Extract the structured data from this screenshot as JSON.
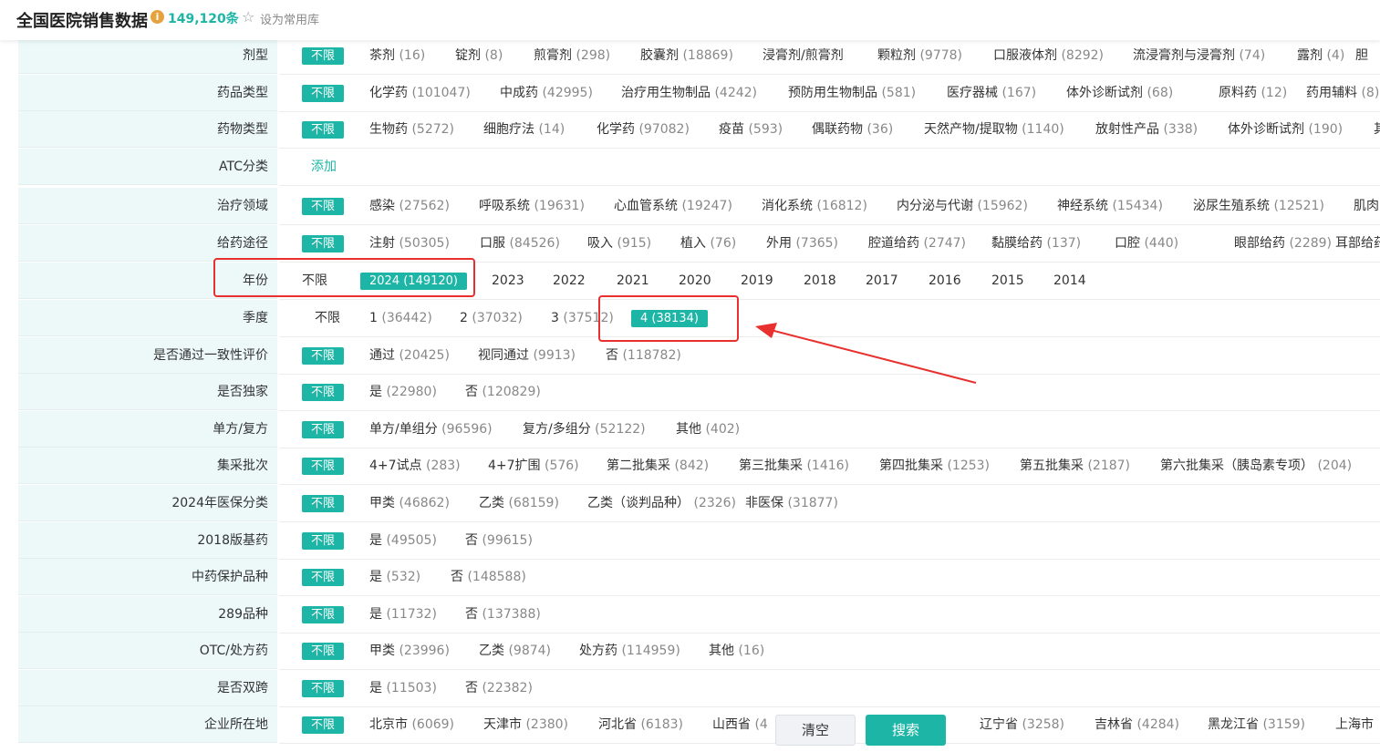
{
  "header": {
    "title": "全国医院销售数据",
    "info_icon": "i",
    "count": "149,120条",
    "star_icon": "☆",
    "favorite_label": "设为常用库"
  },
  "rows": [
    {
      "label": "剂型",
      "options": [
        {
          "text": "不限",
          "sel": true
        },
        {
          "text": "茶剂",
          "count": "(16)"
        },
        {
          "text": "锭剂",
          "count": "(8)"
        },
        {
          "text": "煎膏剂",
          "count": "(298)"
        },
        {
          "text": "胶囊剂",
          "count": "(18869)"
        },
        {
          "text": "浸膏剂/煎膏剂"
        },
        {
          "text": "颗粒剂",
          "count": "(9778)"
        },
        {
          "text": "口服液体剂",
          "count": "(8292)"
        },
        {
          "text": "流浸膏剂与浸膏剂",
          "count": "(74)"
        },
        {
          "text": "露剂",
          "count": "(4)"
        },
        {
          "text": "胆"
        }
      ]
    },
    {
      "label": "药品类型",
      "options": [
        {
          "text": "不限",
          "sel": true
        },
        {
          "text": "化学药",
          "count": "(101047)"
        },
        {
          "text": "中成药",
          "count": "(42995)"
        },
        {
          "text": "治疗用生物制品",
          "count": "(4242)"
        },
        {
          "text": "预防用生物制品",
          "count": "(581)"
        },
        {
          "text": "医疗器械",
          "count": "(167)"
        },
        {
          "text": "体外诊断试剂",
          "count": "(68)"
        },
        {
          "text": "原料药",
          "count": "(12)"
        },
        {
          "text": "药用辅料",
          "count": "(8)"
        }
      ]
    },
    {
      "label": "药物类型",
      "options": [
        {
          "text": "不限",
          "sel": true
        },
        {
          "text": "生物药",
          "count": "(5272)"
        },
        {
          "text": "细胞疗法",
          "count": "(14)"
        },
        {
          "text": "化学药",
          "count": "(97082)"
        },
        {
          "text": "疫苗",
          "count": "(593)"
        },
        {
          "text": "偶联药物",
          "count": "(36)"
        },
        {
          "text": "天然产物/提取物",
          "count": "(1140)"
        },
        {
          "text": "放射性产品",
          "count": "(338)"
        },
        {
          "text": "体外诊断试剂",
          "count": "(190)"
        },
        {
          "text": "其"
        }
      ]
    },
    {
      "label": "ATC分类",
      "options": [
        {
          "text": "添加",
          "add": true
        }
      ]
    },
    {
      "label": "治疗领域",
      "options": [
        {
          "text": "不限",
          "sel": true
        },
        {
          "text": "感染",
          "count": "(27562)"
        },
        {
          "text": "呼吸系统",
          "count": "(19631)"
        },
        {
          "text": "心血管系统",
          "count": "(19247)"
        },
        {
          "text": "消化系统",
          "count": "(16812)"
        },
        {
          "text": "内分泌与代谢",
          "count": "(15962)"
        },
        {
          "text": "神经系统",
          "count": "(15434)"
        },
        {
          "text": "泌尿生殖系统",
          "count": "(12521)"
        },
        {
          "text": "肌肉"
        }
      ]
    },
    {
      "label": "给药途径",
      "options": [
        {
          "text": "不限",
          "sel": true
        },
        {
          "text": "注射",
          "count": "(50305)"
        },
        {
          "text": "口服",
          "count": "(84526)"
        },
        {
          "text": "吸入",
          "count": "(915)"
        },
        {
          "text": "植入",
          "count": "(76)"
        },
        {
          "text": "外用",
          "count": "(7365)"
        },
        {
          "text": "腔道给药",
          "count": "(2747)"
        },
        {
          "text": "黏膜给药",
          "count": "(137)"
        },
        {
          "text": "口腔",
          "count": "(440)"
        },
        {
          "text": "眼部给药",
          "count": "(2289)"
        },
        {
          "text": "耳部给药"
        }
      ]
    },
    {
      "label": "年份",
      "options": [
        {
          "text": "不限"
        },
        {
          "text": "2024",
          "count": "(149120)",
          "sel": true
        },
        {
          "text": "2023"
        },
        {
          "text": "2022"
        },
        {
          "text": "2021"
        },
        {
          "text": "2020"
        },
        {
          "text": "2019"
        },
        {
          "text": "2018"
        },
        {
          "text": "2017"
        },
        {
          "text": "2016"
        },
        {
          "text": "2015"
        },
        {
          "text": "2014"
        }
      ]
    },
    {
      "label": "季度",
      "options": [
        {
          "text": "不限"
        },
        {
          "text": "1",
          "count": "(36442)"
        },
        {
          "text": "2",
          "count": "(37032)"
        },
        {
          "text": "3",
          "count": "(37512)"
        },
        {
          "text": "4",
          "count": "(38134)",
          "sel": true
        }
      ]
    },
    {
      "label": "是否通过一致性评价",
      "options": [
        {
          "text": "不限",
          "sel": true
        },
        {
          "text": "通过",
          "count": "(20425)"
        },
        {
          "text": "视同通过",
          "count": "(9913)"
        },
        {
          "text": "否",
          "count": "(118782)"
        }
      ]
    },
    {
      "label": "是否独家",
      "options": [
        {
          "text": "不限",
          "sel": true
        },
        {
          "text": "是",
          "count": "(22980)"
        },
        {
          "text": "否",
          "count": "(120829)"
        }
      ]
    },
    {
      "label": "单方/复方",
      "options": [
        {
          "text": "不限",
          "sel": true
        },
        {
          "text": "单方/单组分",
          "count": "(96596)"
        },
        {
          "text": "复方/多组分",
          "count": "(52122)"
        },
        {
          "text": "其他",
          "count": "(402)"
        }
      ]
    },
    {
      "label": "集采批次",
      "options": [
        {
          "text": "不限",
          "sel": true
        },
        {
          "text": "4+7试点",
          "count": "(283)"
        },
        {
          "text": "4+7扩围",
          "count": "(576)"
        },
        {
          "text": "第二批集采",
          "count": "(842)"
        },
        {
          "text": "第三批集采",
          "count": "(1416)"
        },
        {
          "text": "第四批集采",
          "count": "(1253)"
        },
        {
          "text": "第五批集采",
          "count": "(2187)"
        },
        {
          "text": "第六批集采（胰岛素专项）",
          "count": "(204)"
        }
      ]
    },
    {
      "label": "2024年医保分类",
      "options": [
        {
          "text": "不限",
          "sel": true
        },
        {
          "text": "甲类",
          "count": "(46862)"
        },
        {
          "text": "乙类",
          "count": "(68159)"
        },
        {
          "text": "乙类（谈判品种）",
          "count": "(2326)"
        },
        {
          "text": "非医保",
          "count": "(31877)"
        }
      ]
    },
    {
      "label": "2018版基药",
      "options": [
        {
          "text": "不限",
          "sel": true
        },
        {
          "text": "是",
          "count": "(49505)"
        },
        {
          "text": "否",
          "count": "(99615)"
        }
      ]
    },
    {
      "label": "中药保护品种",
      "options": [
        {
          "text": "不限",
          "sel": true
        },
        {
          "text": "是",
          "count": "(532)"
        },
        {
          "text": "否",
          "count": "(148588)"
        }
      ]
    },
    {
      "label": "289品种",
      "options": [
        {
          "text": "不限",
          "sel": true
        },
        {
          "text": "是",
          "count": "(11732)"
        },
        {
          "text": "否",
          "count": "(137388)"
        }
      ]
    },
    {
      "label": "OTC/处方药",
      "options": [
        {
          "text": "不限",
          "sel": true
        },
        {
          "text": "甲类",
          "count": "(23996)"
        },
        {
          "text": "乙类",
          "count": "(9874)"
        },
        {
          "text": "处方药",
          "count": "(114959)"
        },
        {
          "text": "其他",
          "count": "(16)"
        }
      ]
    },
    {
      "label": "是否双跨",
      "options": [
        {
          "text": "不限",
          "sel": true
        },
        {
          "text": "是",
          "count": "(11503)"
        },
        {
          "text": "否",
          "count": "(22382)"
        }
      ]
    },
    {
      "label": "企业所在地",
      "options": [
        {
          "text": "不限",
          "sel": true
        },
        {
          "text": "北京市",
          "count": "(6069)"
        },
        {
          "text": "天津市",
          "count": "(2380)"
        },
        {
          "text": "河北省",
          "count": "(6183)"
        },
        {
          "text": "山西省",
          "count": "(4"
        },
        {
          "text": "辽宁省",
          "count": "(3258)"
        },
        {
          "text": "吉林省",
          "count": "(4284)"
        },
        {
          "text": "黑龙江省",
          "count": "(3159)"
        },
        {
          "text": "上海市"
        }
      ]
    }
  ],
  "footer": {
    "clear_label": "清空",
    "search_label": "搜索"
  },
  "colors": {
    "accent": "#1db5a5",
    "highlight": "#e8302f",
    "label_bg": "#edf9f9"
  }
}
